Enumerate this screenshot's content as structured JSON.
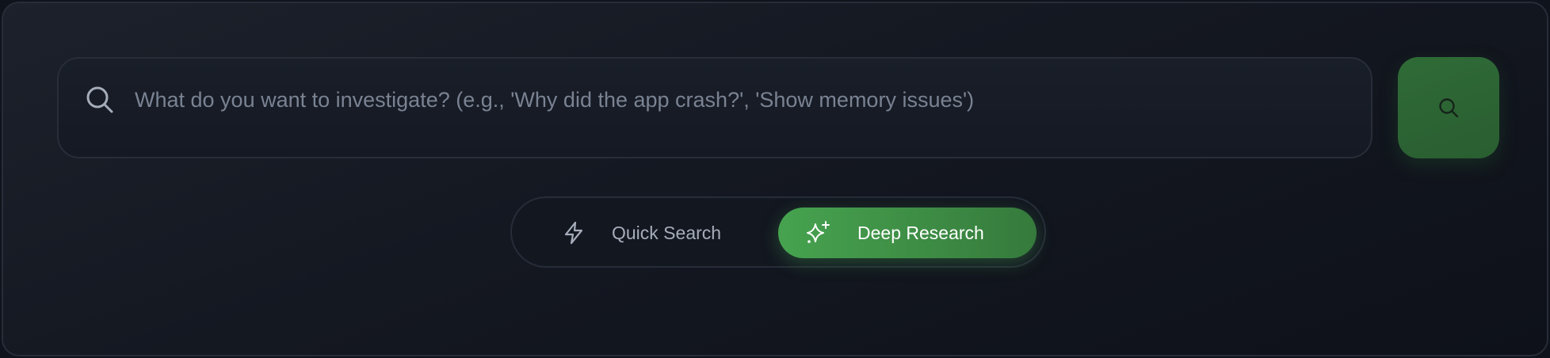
{
  "search": {
    "placeholder": "What do you want to investigate? (e.g., 'Why did the app crash?', 'Show memory issues')",
    "value": "",
    "leading_icon": "search-icon",
    "submit_icon": "search-icon"
  },
  "modes": {
    "options": [
      {
        "label": "Quick Search",
        "icon": "lightning-icon",
        "selected": false
      },
      {
        "label": "Deep Research",
        "icon": "sparkles-icon",
        "selected": true
      }
    ]
  },
  "colors": {
    "accent": "#46a34f",
    "accent_dark": "#2f6b37",
    "panel_bg": "#151923",
    "placeholder_text": "#7a8393"
  }
}
